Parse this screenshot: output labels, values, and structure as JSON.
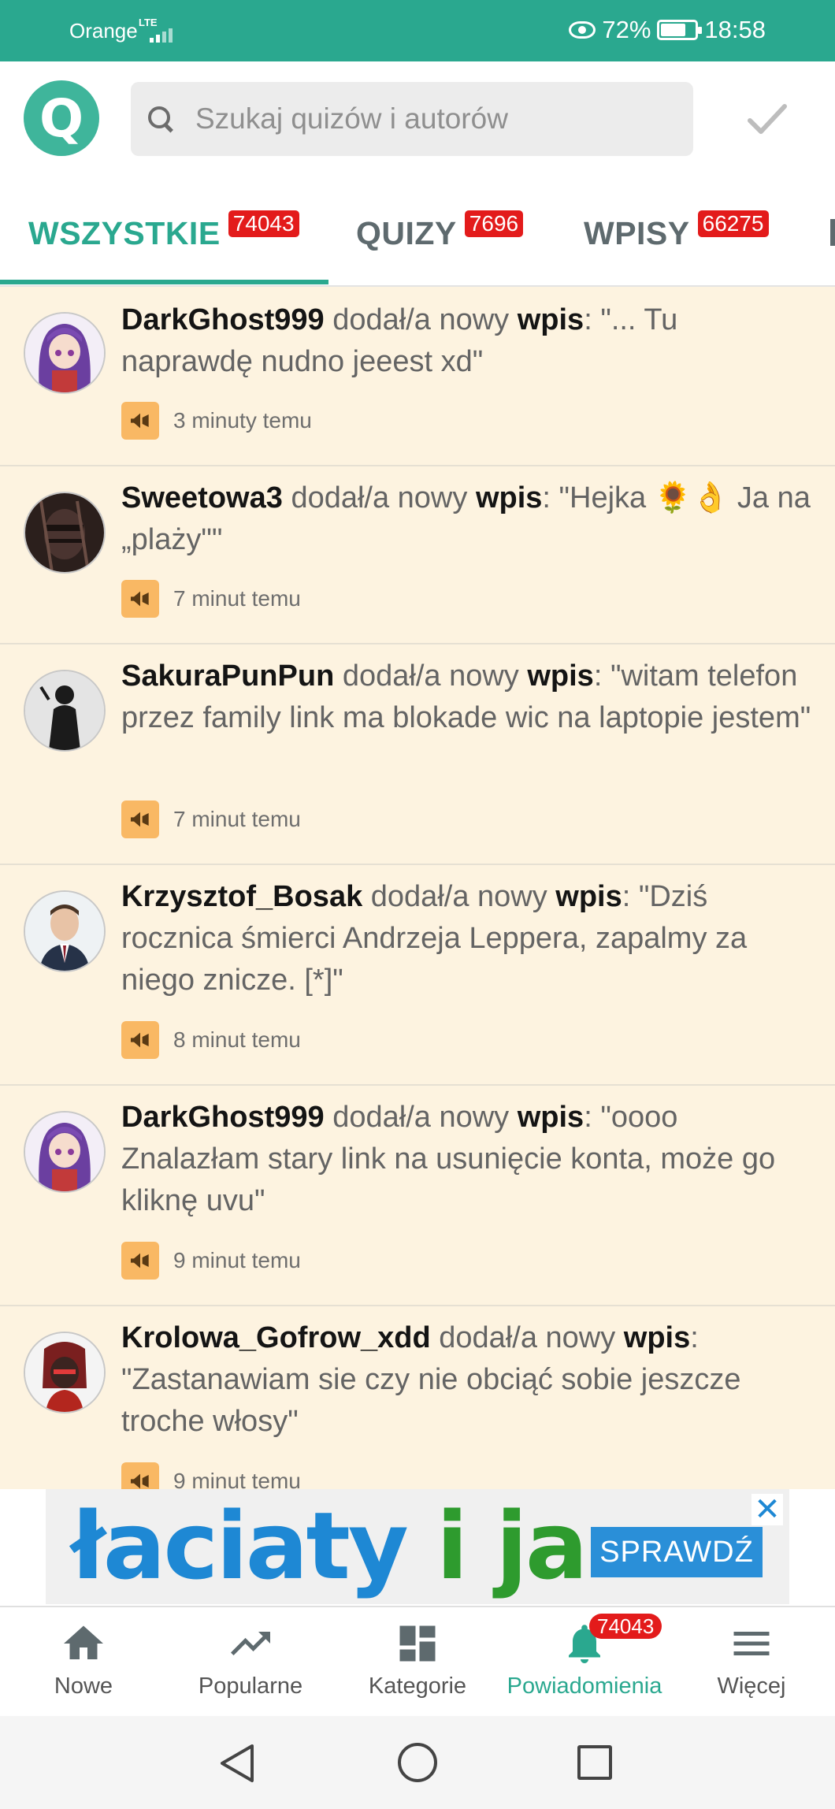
{
  "status_bar": {
    "carrier": "Orange",
    "network": "LTE",
    "battery": "72%",
    "time": "18:58"
  },
  "search": {
    "placeholder": "Szukaj quizów i autorów"
  },
  "logo": {
    "letter": "Q"
  },
  "tabs": [
    {
      "label": "WSZYSTKIE",
      "badge": "74043",
      "active": true
    },
    {
      "label": "QUIZY",
      "badge": "7696",
      "active": false
    },
    {
      "label": "WPISY",
      "badge": "66275",
      "active": false
    }
  ],
  "feed": [
    {
      "user": "DarkGhost999",
      "action": "dodał/a nowy",
      "kind": "wpis",
      "content": "\"... Tu naprawdę nudno jeeest xd\"",
      "time": "3 minuty temu",
      "avatar": "anime-girl-purple"
    },
    {
      "user": "Sweetowa3",
      "action": "dodał/a nowy",
      "kind": "wpis",
      "content": "\"Hejka 🌻👌 Ja na „plaży\"\"",
      "time": "7 minut temu",
      "avatar": "dark-face"
    },
    {
      "user": "SakuraPunPun",
      "action": "dodał/a nowy",
      "kind": "wpis",
      "content": "\"witam telefon przez family link ma blokade wic na laptopie jestem\"",
      "time": "7 minut temu",
      "avatar": "dark-figure"
    },
    {
      "user": "Krzysztof_Bosak",
      "action": "dodał/a nowy",
      "kind": "wpis",
      "content": "\"Dziś rocznica śmierci Andrzeja Leppera, zapalmy za niego znicze. [*]\"",
      "time": "8 minut temu",
      "avatar": "man-in-suit"
    },
    {
      "user": "DarkGhost999",
      "action": "dodał/a nowy",
      "kind": "wpis",
      "content": "\"oooo Znalazłam stary link na usunięcie konta, może go kliknę uvu\"",
      "time": "9 minut temu",
      "avatar": "anime-girl-purple"
    },
    {
      "user": "Krolowa_Gofrow_xdd",
      "action": "dodał/a nowy",
      "kind": "wpis",
      "content": "\"Zastanawiam sie czy nie obciąć sobie jeszcze troche włosy\"",
      "time": "9 minut temu",
      "avatar": "red-character"
    }
  ],
  "ad": {
    "word_part1": "łaciaty",
    "word_part2": " i ",
    "word_part3": "ja",
    "cta": "SPRAWDŹ",
    "close": "✕"
  },
  "bottom_nav": [
    {
      "label": "Nowe",
      "icon": "home-icon"
    },
    {
      "label": "Popularne",
      "icon": "trending-icon"
    },
    {
      "label": "Kategorie",
      "icon": "dashboard-icon"
    },
    {
      "label": "Powiadomienia",
      "icon": "bell-icon",
      "badge": "74043",
      "active": true
    },
    {
      "label": "Więcej",
      "icon": "menu-icon"
    }
  ],
  "colors": {
    "accent": "#2aa88f",
    "badge": "#e31b1b",
    "feed_bg": "#fdf3e0",
    "horn_bg": "#f9b864"
  }
}
